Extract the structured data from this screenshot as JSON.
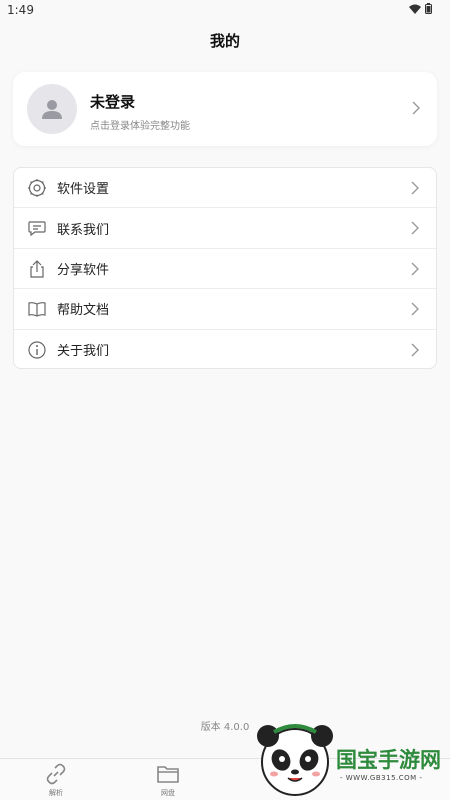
{
  "status_bar": {
    "time": "1:49"
  },
  "header": {
    "title": "我的"
  },
  "profile": {
    "name": "未登录",
    "hint": "点击登录体验完整功能"
  },
  "menu": {
    "items": [
      {
        "label": "软件设置",
        "icon": "settings-icon"
      },
      {
        "label": "联系我们",
        "icon": "chat-icon"
      },
      {
        "label": "分享软件",
        "icon": "share-icon"
      },
      {
        "label": "帮助文档",
        "icon": "book-icon"
      },
      {
        "label": "关于我们",
        "icon": "info-icon"
      }
    ]
  },
  "footer": {
    "version": "版本 4.0.0"
  },
  "tabs": [
    {
      "label": "解析",
      "icon": "link-icon"
    },
    {
      "label": "网盘",
      "icon": "folder-icon"
    }
  ],
  "watermark": {
    "text": "国宝手游网",
    "url": "- WWW.GB315.COM -"
  },
  "colors": {
    "background": "#f9f9f9",
    "card": "#ffffff",
    "watermark_green": "#2e8b3d"
  }
}
